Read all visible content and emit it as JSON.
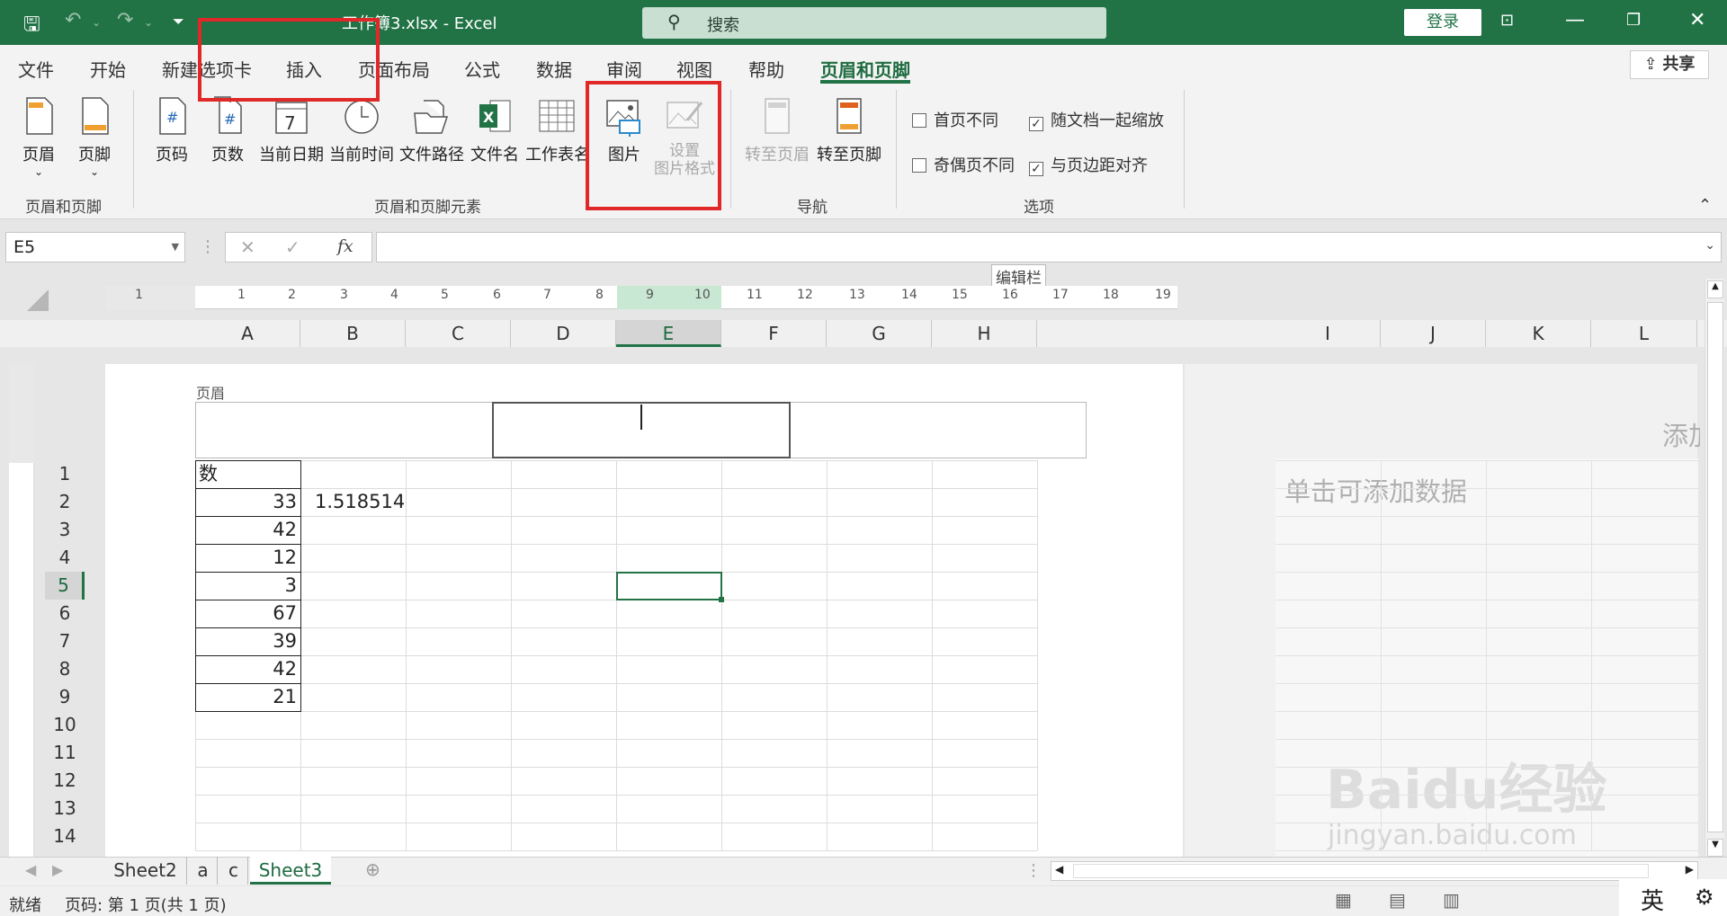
{
  "title_bar": {
    "file_title": "工作簿3.xlsx - Excel",
    "search_placeholder": "搜索",
    "login_label": "登录"
  },
  "tabs": [
    "文件",
    "开始",
    "新建选项卡",
    "插入",
    "页面布局",
    "公式",
    "数据",
    "审阅",
    "视图",
    "帮助",
    "页眉和页脚"
  ],
  "active_tab": "页眉和页脚",
  "share_label": "共享",
  "ribbon": {
    "group1": {
      "buttons": [
        "页眉",
        "页脚"
      ],
      "label": "页眉和页脚"
    },
    "group2": {
      "buttons": [
        "页码",
        "页数",
        "当前日期",
        "当前时间",
        "文件路径",
        "文件名",
        "工作表名",
        "图片"
      ],
      "set_picture_format": "设置",
      "set_picture_format_line2": "图片格式",
      "label": "页眉和页脚元素"
    },
    "group3": {
      "buttons": [
        "转至页眉",
        "转至页脚"
      ],
      "label": "导航"
    },
    "group4": {
      "options": [
        {
          "label": "首页不同",
          "checked": false
        },
        {
          "label": "随文档一起缩放",
          "checked": true
        },
        {
          "label": "奇偶页不同",
          "checked": false
        },
        {
          "label": "与页边距对齐",
          "checked": true
        }
      ],
      "label": "选项"
    }
  },
  "formula_bar": {
    "name_box": "E5",
    "fx": "fx",
    "tooltip": "编辑栏",
    "value": ""
  },
  "ruler": [
    "1",
    "1",
    "2",
    "3",
    "4",
    "5",
    "6",
    "7",
    "8",
    "9",
    "10",
    "11",
    "12",
    "13",
    "14",
    "15",
    "16",
    "17",
    "18",
    "19"
  ],
  "columns": [
    "A",
    "B",
    "C",
    "D",
    "E",
    "F",
    "G",
    "H",
    "I",
    "J",
    "K",
    "L"
  ],
  "rows": [
    "1",
    "2",
    "3",
    "4",
    "5",
    "6",
    "7",
    "8",
    "9",
    "10",
    "11",
    "12",
    "13",
    "14"
  ],
  "header_label": "页眉",
  "cells": {
    "A1": "数",
    "A2": "33",
    "B2": "1.518514",
    "A3": "42",
    "A4": "12",
    "A5": "3",
    "A6": "67",
    "A7": "39",
    "A8": "42",
    "A9": "21"
  },
  "right_page": {
    "add_header_partial": "添加",
    "click_add_data": "单击可添加数据"
  },
  "sheet_tabs": [
    "Sheet2",
    "a",
    "c",
    "Sheet3"
  ],
  "active_sheet": "Sheet3",
  "status": {
    "ready": "就绪",
    "page_info": "页码: 第 1 页(共 1 页)",
    "ime": "英"
  },
  "watermark": {
    "brand": "Baidu经验",
    "url": "jingyan.baidu.com"
  },
  "colors": {
    "excel_green": "#217346",
    "highlight_red": "#e02828"
  }
}
